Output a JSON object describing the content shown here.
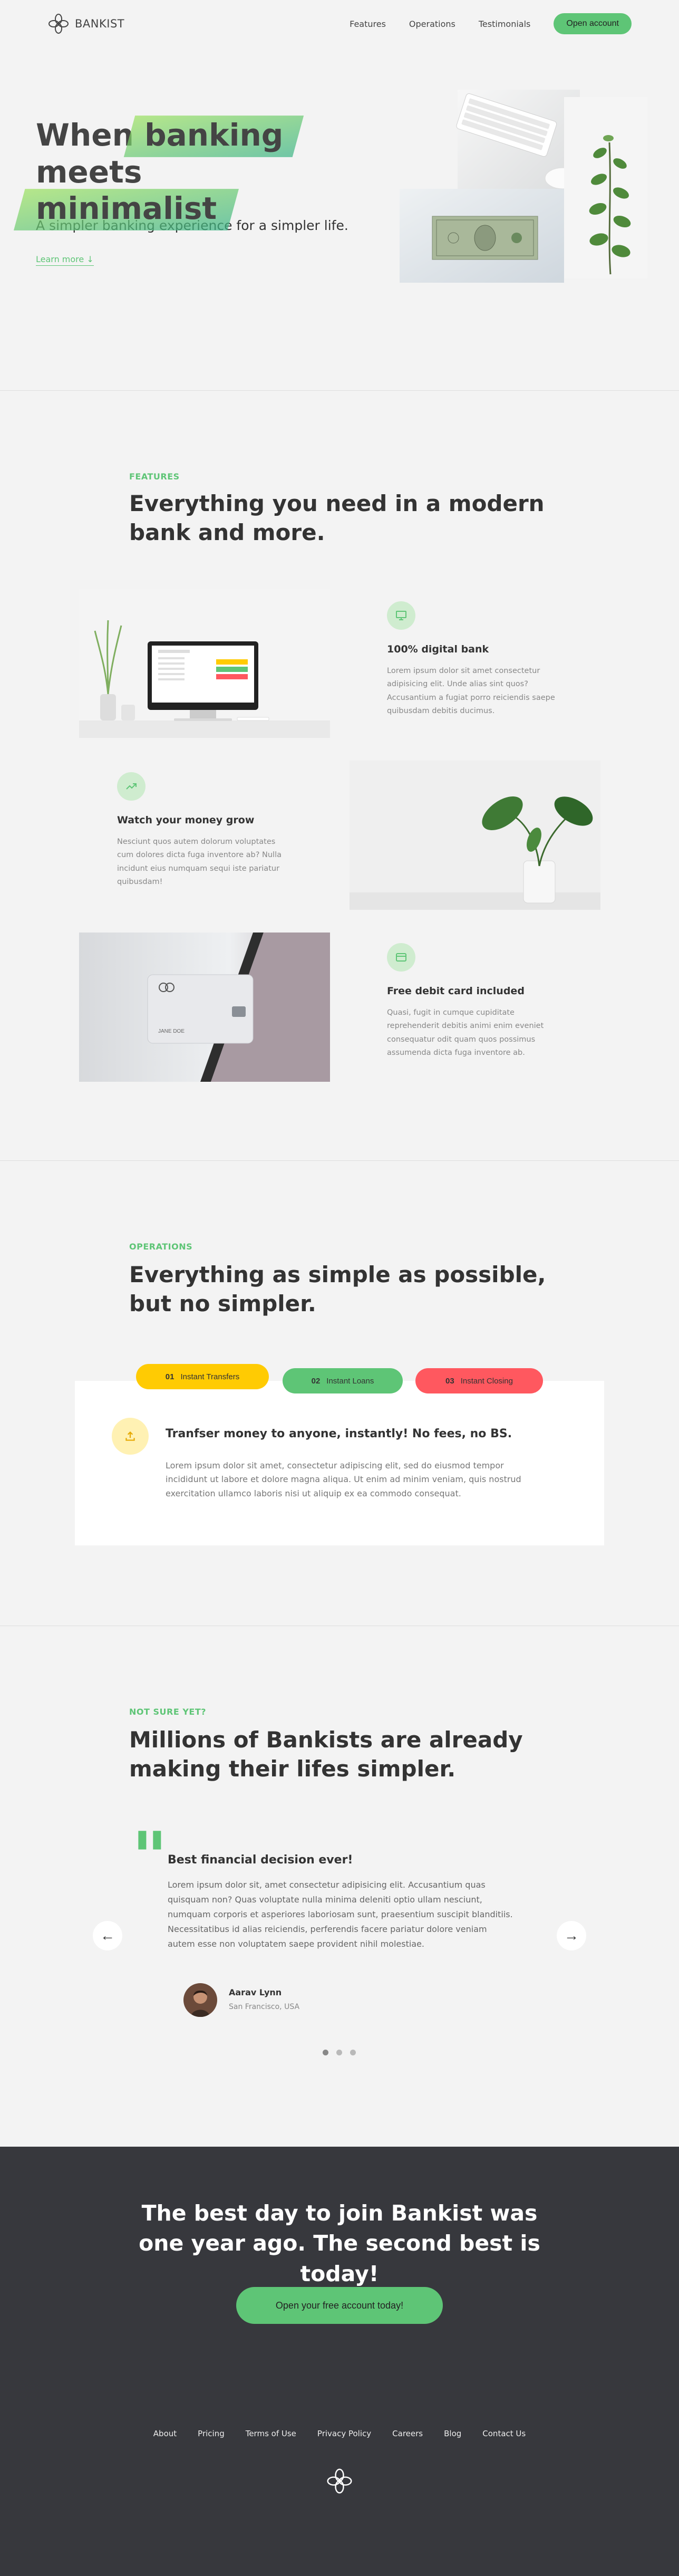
{
  "nav": {
    "brand": "BANKIST",
    "links": [
      "Features",
      "Operations",
      "Testimonials"
    ],
    "cta": "Open account"
  },
  "header": {
    "title_word1": "When",
    "title_hl1": "banking",
    "title_word2": "meets",
    "title_hl2": "minimalist",
    "subtitle": "A simpler banking experience for a simpler life.",
    "learn_more": "Learn more ↓",
    "banknote_text": "ONE"
  },
  "features": {
    "tag": "FEATURES",
    "title": "Everything you need in a modern bank and more.",
    "items": [
      {
        "heading": "100% digital bank",
        "text": "Lorem ipsum dolor sit amet consectetur adipisicing elit. Unde alias sint quos? Accusantium a fugiat porro reiciendis saepe quibusdam debitis ducimus.",
        "icon": "monitor-icon"
      },
      {
        "heading": "Watch your money grow",
        "text": "Nesciunt quos autem dolorum voluptates cum dolores dicta fuga inventore ab? Nulla incidunt eius numquam sequi iste pariatur quibusdam!",
        "icon": "trending-up-icon"
      },
      {
        "heading": "Free debit card included",
        "text": "Quasi, fugit in cumque cupiditate reprehenderit debitis animi enim eveniet consequatur odit quam quos possimus assumenda dicta fuga inventore ab.",
        "icon": "credit-card-icon"
      }
    ],
    "card_text": "JANE DOE"
  },
  "operations": {
    "tag": "OPERATIONS",
    "title": "Everything as simple as possible, but no simpler.",
    "tabs": [
      {
        "num": "01",
        "label": "Instant Transfers",
        "color": "#ffcb03"
      },
      {
        "num": "02",
        "label": "Instant Loans",
        "color": "#5ec576"
      },
      {
        "num": "03",
        "label": "Instant Closing",
        "color": "#ff585f"
      }
    ],
    "content_heading": "Tranfser money to anyone, instantly! No fees, no BS.",
    "content_text": "Lorem ipsum dolor sit amet, consectetur adipiscing elit, sed do eiusmod tempor incididunt ut labore et dolore magna aliqua. Ut enim ad minim veniam, quis nostrud exercitation ullamco laboris nisi ut aliquip ex ea commodo consequat."
  },
  "testimonials": {
    "tag": "NOT SURE YET?",
    "title": "Millions of Bankists are already making their lifes simpler.",
    "quote_heading": "Best financial decision ever!",
    "quote_text": "Lorem ipsum dolor sit, amet consectetur adipisicing elit. Accusantium quas quisquam non? Quas voluptate nulla minima deleniti optio ullam nesciunt, numquam corporis et asperiores laboriosam sunt, praesentium suscipit blanditiis. Necessitatibus id alias reiciendis, perferendis facere pariatur dolore veniam autem esse non voluptatem saepe provident nihil molestiae.",
    "author": "Aarav Lynn",
    "location": "San Francisco, USA",
    "slide_count": 3,
    "active_slide": 1
  },
  "cta": {
    "title": "The best day to join Bankist was one year ago. The second best is today!",
    "button": "Open your free account today!"
  },
  "footer": {
    "links": [
      "About",
      "Pricing",
      "Terms of Use",
      "Privacy Policy",
      "Careers",
      "Blog",
      "Contact Us"
    ]
  },
  "colors": {
    "primary": "#5ec576",
    "secondary": "#ffcb03",
    "tertiary": "#ff585f",
    "dark": "#37383d"
  }
}
